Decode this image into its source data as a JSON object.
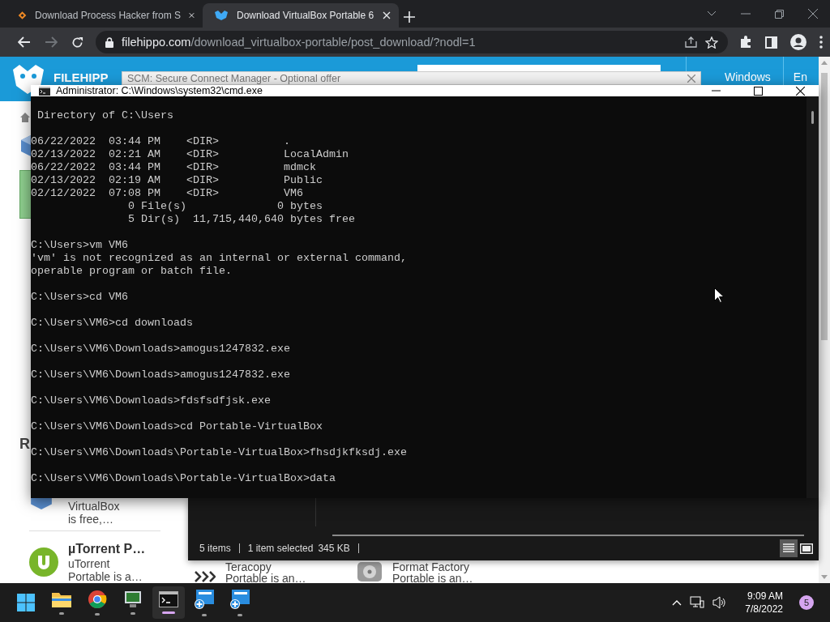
{
  "browser": {
    "tabs": [
      {
        "title": "Download Process Hacker from S",
        "selected": false
      },
      {
        "title": "Download VirtualBox Portable 6",
        "selected": true
      }
    ],
    "forward_disabled": true,
    "address": {
      "host": "filehippo.com",
      "path": "/download_virtualbox-portable/post_download/?nodl=1"
    }
  },
  "page": {
    "logo": "FILEHIPP",
    "offer_bar": "SCM: Secure Connect Manager - Optional offer",
    "nav": [
      "Windows",
      "En"
    ],
    "section_heading": "R",
    "featured": {
      "name": "VirtualBox",
      "blurb": "is free,…"
    },
    "apps": [
      {
        "title": "µTorrent P…",
        "name": "uTorrent",
        "blurb": "Portable is a…"
      },
      {
        "name": "Teracopy",
        "blurb": "Portable is an…"
      },
      {
        "name": "Format Factory",
        "blurb": "Portable is an…"
      }
    ]
  },
  "cmd": {
    "title": "Administrator: C:\\Windows\\system32\\cmd.exe",
    "blocks": [
      " Directory of C:\\Users",
      "06/22/2022  03:44 PM    <DIR>          .\n02/13/2022  02:21 AM    <DIR>          LocalAdmin\n06/22/2022  03:44 PM    <DIR>          mdmck\n02/13/2022  02:19 AM    <DIR>          Public\n02/12/2022  07:08 PM    <DIR>          VM6\n               0 File(s)              0 bytes\n               5 Dir(s)  11,715,440,640 bytes free",
      "C:\\Users>vm VM6\n'vm' is not recognized as an internal or external command,\noperable program or batch file.",
      "C:\\Users>cd VM6",
      "C:\\Users\\VM6>cd downloads",
      "C:\\Users\\VM6\\Downloads>amogus1247832.exe",
      "C:\\Users\\VM6\\Downloads>amogus1247832.exe",
      "C:\\Users\\VM6\\Downloads>fdsfsdfjsk.exe",
      "C:\\Users\\VM6\\Downloads>cd Portable-VirtualBox",
      "C:\\Users\\VM6\\Downloads\\Portable-VirtualBox>fhsdjkfksdj.exe",
      "C:\\Users\\VM6\\Downloads\\Portable-VirtualBox>data"
    ]
  },
  "explorer": {
    "status": [
      "5 items",
      "1 item selected",
      "345 KB"
    ],
    "views": [
      {
        "kind": "details",
        "selected": true
      },
      {
        "kind": "tiles",
        "selected": false
      }
    ]
  },
  "taskbar": {
    "apps": [
      {
        "kind": "explorer",
        "selected": false
      },
      {
        "kind": "chrome",
        "selected": false
      },
      {
        "kind": "monitor",
        "selected": false
      },
      {
        "kind": "terminal",
        "selected": true
      },
      {
        "kind": "setup",
        "selected": false
      },
      {
        "kind": "setup",
        "selected": false
      }
    ],
    "time": "9:09 AM",
    "date": "7/8/2022",
    "notifications": "5"
  }
}
